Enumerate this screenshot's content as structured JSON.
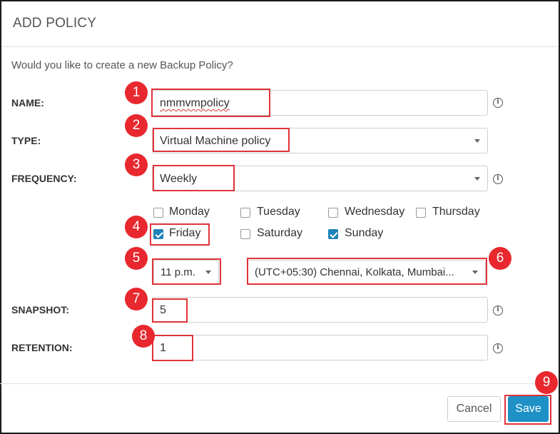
{
  "dialog": {
    "title": "ADD POLICY",
    "question": "Would you like to create a new Backup Policy?"
  },
  "form": {
    "name": {
      "label": "NAME:",
      "value": "nmmvmpolicy",
      "info_icon": "info-icon"
    },
    "type": {
      "label": "TYPE:",
      "value": "Virtual Machine policy"
    },
    "frequency": {
      "label": "FREQUENCY:",
      "value": "Weekly",
      "info_icon": "info-icon"
    },
    "days": [
      {
        "label": "Monday",
        "checked": false
      },
      {
        "label": "Tuesday",
        "checked": false
      },
      {
        "label": "Wednesday",
        "checked": false
      },
      {
        "label": "Thursday",
        "checked": false
      },
      {
        "label": "Friday",
        "checked": true
      },
      {
        "label": "Saturday",
        "checked": false
      },
      {
        "label": "Sunday",
        "checked": true
      }
    ],
    "time": {
      "value": "11 p.m."
    },
    "timezone": {
      "value": "(UTC+05:30) Chennai, Kolkata, Mumbai..."
    },
    "snapshot": {
      "label": "SNAPSHOT:",
      "value": "5",
      "info_icon": "info-icon"
    },
    "retention": {
      "label": "RETENTION:",
      "value": "1",
      "info_icon": "info-icon"
    }
  },
  "footer": {
    "cancel_label": "Cancel",
    "save_label": "Save"
  },
  "callouts": [
    "1",
    "2",
    "3",
    "4",
    "5",
    "6",
    "7",
    "8",
    "9"
  ],
  "colors": {
    "accent": "#1e91c6",
    "checkbox_checked": "#1e82b7",
    "callout": "#e8282e",
    "highlight_box": "#e0333a"
  }
}
